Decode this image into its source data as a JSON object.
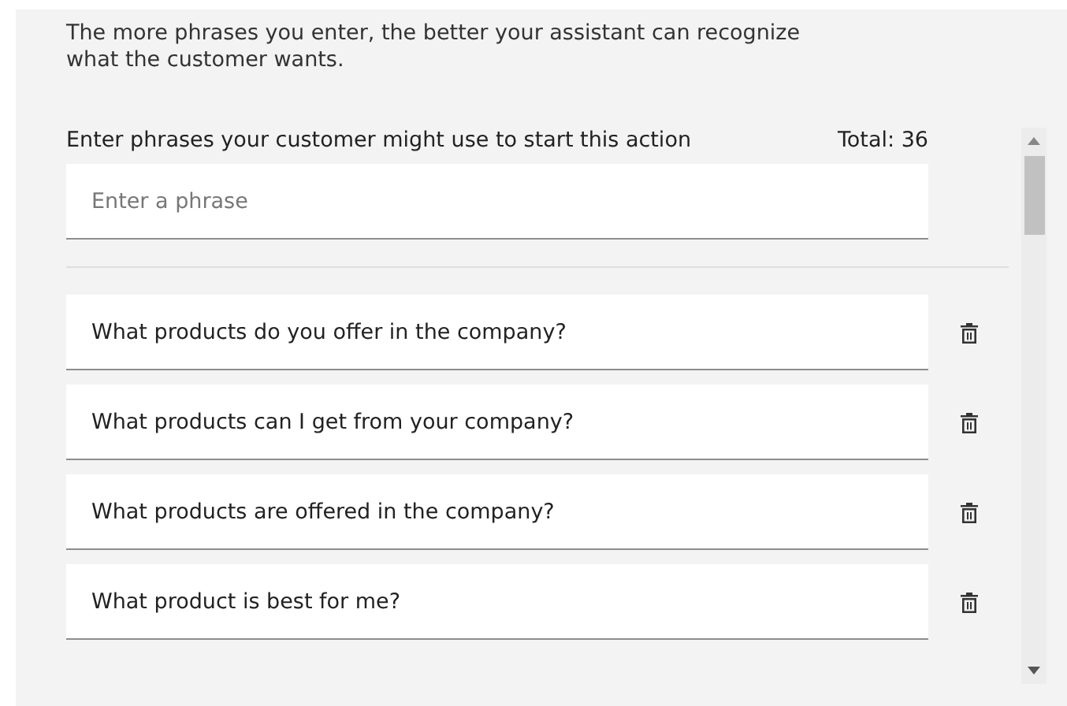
{
  "description": "The more phrases you enter, the better your assistant can recognize what the customer wants.",
  "phrases_label": "Enter phrases your customer might use to start this action",
  "total": "Total: 36",
  "phrase_field": {
    "placeholder": "Enter a phrase"
  },
  "phrases": [
    {
      "text": "What products do you offer in the company?"
    },
    {
      "text": "What products can I get from your company?"
    },
    {
      "text": "What products are offered in the company?"
    },
    {
      "text": "What product is best for me?"
    }
  ]
}
